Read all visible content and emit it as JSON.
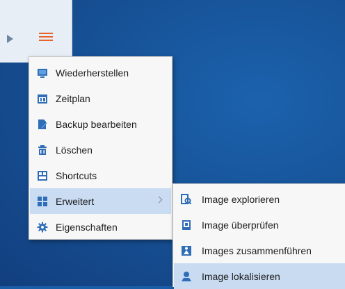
{
  "menu": {
    "items": [
      {
        "label": "Wiederherstellen",
        "icon": "restore-icon"
      },
      {
        "label": "Zeitplan",
        "icon": "calendar-icon"
      },
      {
        "label": "Backup bearbeiten",
        "icon": "edit-backup-icon"
      },
      {
        "label": "Löschen",
        "icon": "trash-icon"
      },
      {
        "label": "Shortcuts",
        "icon": "shortcut-icon"
      },
      {
        "label": "Erweitert",
        "icon": "advanced-grid-icon"
      },
      {
        "label": "Eigenschaften",
        "icon": "gear-icon"
      }
    ]
  },
  "submenu": {
    "items": [
      {
        "label": "Image explorieren",
        "icon": "explore-image-icon"
      },
      {
        "label": "Image überprüfen",
        "icon": "check-image-icon"
      },
      {
        "label": "Images zusammenführen",
        "icon": "merge-images-icon"
      },
      {
        "label": "Image lokalisieren",
        "icon": "locate-image-icon"
      }
    ]
  },
  "colors": {
    "accent": "#2f6db8",
    "hamburger": "#e8622a",
    "highlight": "#c9dcf2",
    "background": "#1a5ea8"
  }
}
